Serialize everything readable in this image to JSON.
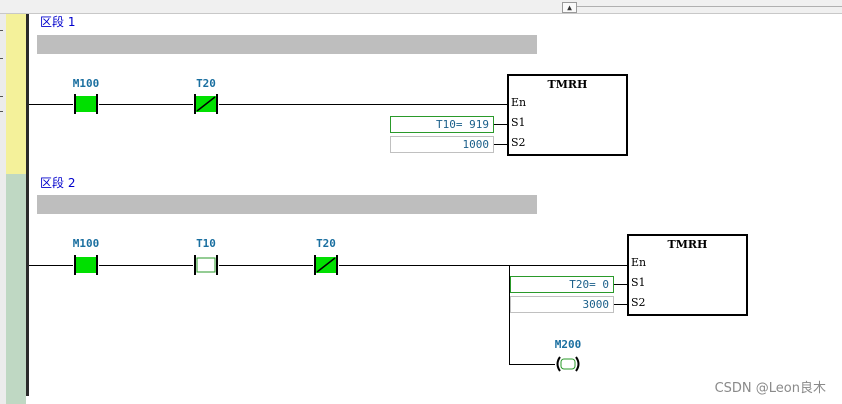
{
  "toolbar": {
    "collapse_glyph": "▲"
  },
  "segments": [
    {
      "label": "区段 1",
      "contacts": [
        {
          "name": "M100",
          "kind": "normally-open",
          "state": "energized"
        },
        {
          "name": "T20",
          "kind": "normally-closed",
          "state": "energized"
        }
      ],
      "block": {
        "title": "TMRH",
        "pins": [
          "En",
          "S1",
          "S2"
        ],
        "s1": "T10= 919",
        "s2": "1000"
      }
    },
    {
      "label": "区段 2",
      "contacts": [
        {
          "name": "M100",
          "kind": "normally-open",
          "state": "energized"
        },
        {
          "name": "T10",
          "kind": "normally-open",
          "state": "off"
        },
        {
          "name": "T20",
          "kind": "normally-closed",
          "state": "energized"
        }
      ],
      "block": {
        "title": "TMRH",
        "pins": [
          "En",
          "S1",
          "S2"
        ],
        "s1": "T20= 0",
        "s2": "3000"
      },
      "coil": {
        "name": "M200",
        "state": "off"
      }
    }
  ],
  "colors": {
    "energized": "#00e000",
    "off": "#ffffff",
    "label": "#1a6fa0",
    "segment_label": "#0000cc"
  },
  "watermark": "CSDN @Leon良木"
}
